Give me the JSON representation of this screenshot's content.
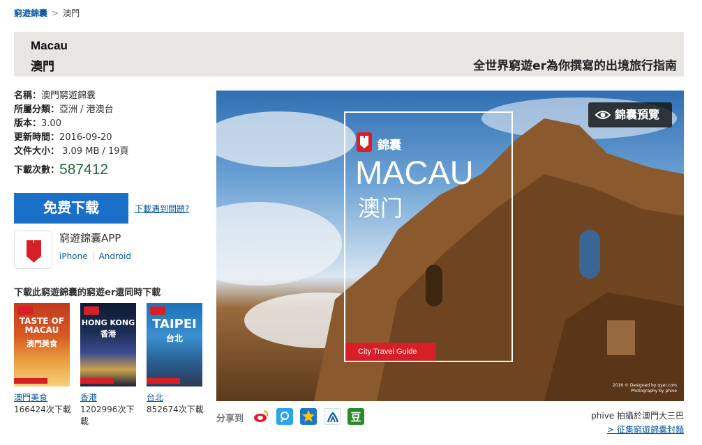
{
  "breadcrumb": {
    "root": "窮遊錦囊",
    "sep": ">",
    "current": "澳門"
  },
  "header": {
    "title_en": "Macau",
    "title_zh": "澳門",
    "slogan": "全世界窮遊er為你撰寫的出境旅行指南"
  },
  "info": {
    "name_k": "名稱：",
    "name_v": "澳門窮遊錦囊",
    "cat_k": "所屬分類：",
    "cat_v": "亞洲 / 港澳台",
    "ver_k": "版本：",
    "ver_v": "3.00",
    "upd_k": "更新時間：",
    "upd_v": "2016-09-20",
    "size_k": "文件大小：",
    "size_v": " 3.09 MB / 19頁",
    "dl_k": "下載次數：",
    "dl_v": "587412"
  },
  "download": {
    "button": "免费下载",
    "help": "下載遇到問題?"
  },
  "app": {
    "name": "窮遊錦囊APP",
    "iphone": "iPhone",
    "android": "Android"
  },
  "also": {
    "title": "下載此窮遊錦囊的窮遊er還同時下載",
    "items": [
      {
        "cover": "TASTE OF MACAU",
        "cover_zh": "澳門美食",
        "label": "澳門美食",
        "count": "166424次下載"
      },
      {
        "cover": "HONG KONG",
        "cover_zh": "香港",
        "label": "香港",
        "count": "1202996次下載"
      },
      {
        "cover": "TAIPEI",
        "cover_zh": "台北",
        "label": "台北",
        "count": "852674次下載"
      }
    ]
  },
  "hero": {
    "preview": "錦囊預覽",
    "brand": "錦囊",
    "city_en": "MACAU",
    "city_zh": "澳门",
    "guide": "City Travel Guide",
    "credit": "2016 © Designed by qyer.com\nPhotography by phive"
  },
  "share": {
    "label": "分享到"
  },
  "photo": {
    "credit": "phive 拍攝於澳門大三巴",
    "collect": "> 征集窮遊錦囊封麵"
  },
  "colors": {
    "brand_red": "#d61f26",
    "link": "#0a5aa6",
    "button": "#1a6fc9",
    "count": "#1f6b3a"
  }
}
